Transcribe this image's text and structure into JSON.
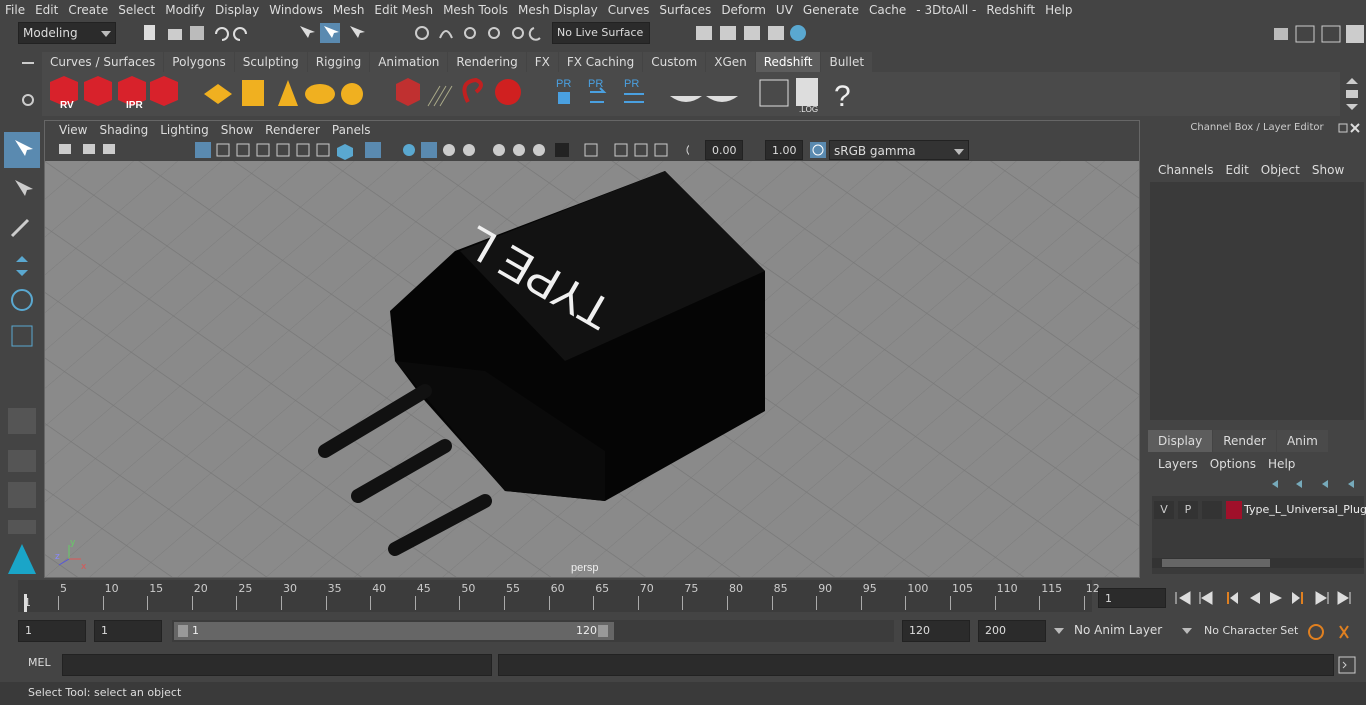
{
  "menu": [
    "File",
    "Edit",
    "Create",
    "Select",
    "Modify",
    "Display",
    "Windows",
    "Mesh",
    "Edit Mesh",
    "Mesh Tools",
    "Mesh Display",
    "Curves",
    "Surfaces",
    "Deform",
    "UV",
    "Generate",
    "Cache",
    "- 3DtoAll -",
    "Redshift",
    "Help"
  ],
  "status": {
    "mode": "Modeling",
    "live_surface": "No Live Surface"
  },
  "shelf_tabs": [
    "Curves / Surfaces",
    "Polygons",
    "Sculpting",
    "Rigging",
    "Animation",
    "Rendering",
    "FX",
    "FX Caching",
    "Custom",
    "XGen",
    "Redshift",
    "Bullet"
  ],
  "shelf_active": "Redshift",
  "shelf_icons": {
    "rv": "RV",
    "ipr": "IPR",
    "pr": "PR",
    "log": ".LOG",
    "help": "?"
  },
  "panel_menu": [
    "View",
    "Shading",
    "Lighting",
    "Show",
    "Renderer",
    "Panels"
  ],
  "panel_tools": {
    "exposure": "0.00",
    "gamma": "1.00",
    "colorspace": "sRGB gamma"
  },
  "viewport": {
    "camera_label": "persp",
    "model_text": "TYPE L",
    "axis_y": "y",
    "axis_z": "z",
    "axis_x": "x"
  },
  "channel_box": {
    "title": "Channel Box / Layer Editor",
    "menu": [
      "Channels",
      "Edit",
      "Object",
      "Show"
    ]
  },
  "layer_editor": {
    "tabs": [
      "Display",
      "Render",
      "Anim"
    ],
    "active_tab": "Display",
    "menu": [
      "Layers",
      "Options",
      "Help"
    ],
    "layers": [
      {
        "v": "V",
        "p": "P",
        "color": "#a0102a",
        "name": "Type_L_Universal_Plug"
      }
    ]
  },
  "timeline": {
    "ticks": [
      "5",
      "10",
      "15",
      "20",
      "25",
      "30",
      "35",
      "40",
      "45",
      "50",
      "55",
      "60",
      "65",
      "70",
      "75",
      "80",
      "85",
      "90",
      "95",
      "100",
      "105",
      "110",
      "115",
      "12"
    ],
    "start_label": "1",
    "current_frame": "1"
  },
  "range": {
    "start": "1",
    "playback_start": "1",
    "slider_start": "1",
    "slider_end": "120",
    "playback_end": "120",
    "end": "200",
    "anim_layer": "No Anim Layer",
    "character_set": "No Character Set"
  },
  "cmd": {
    "label": "MEL"
  },
  "help": {
    "text": "Select Tool: select an object"
  }
}
